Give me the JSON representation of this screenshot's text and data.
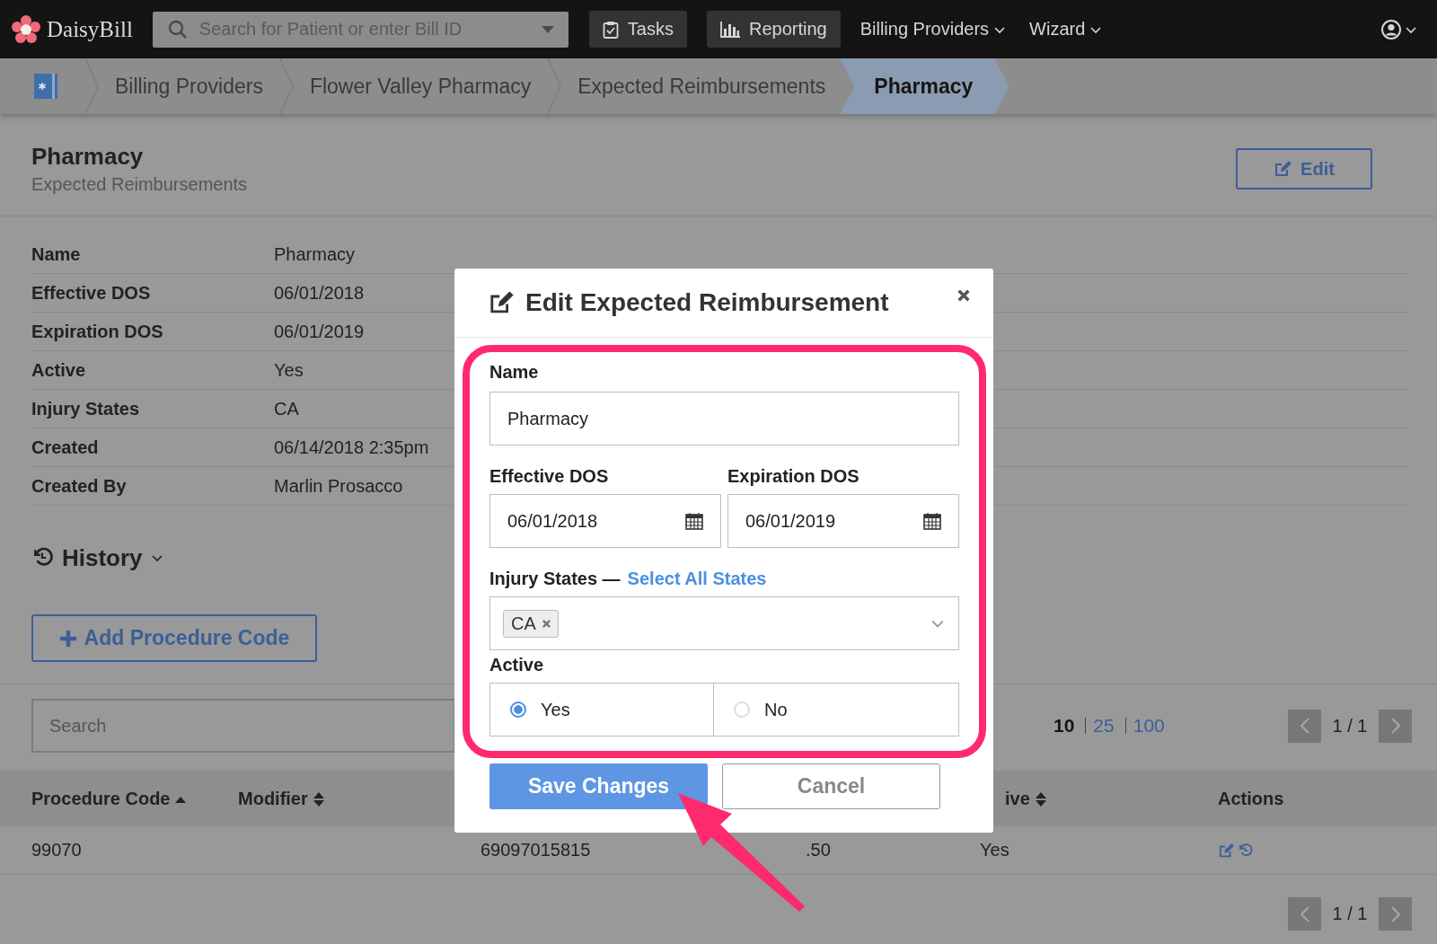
{
  "nav": {
    "logo": "DaisyBill",
    "search": {
      "placeholder": "Search for Patient or enter Bill ID"
    },
    "items": [
      {
        "label": "Tasks",
        "kind": "button"
      },
      {
        "label": "Reporting",
        "kind": "button"
      },
      {
        "label": "Billing Providers",
        "kind": "menu"
      },
      {
        "label": "Wizard",
        "kind": "menu"
      }
    ]
  },
  "breadcrumbs": [
    {
      "label": "Billing Providers",
      "selected": false
    },
    {
      "label": "Flower Valley Pharmacy",
      "selected": false
    },
    {
      "label": "Expected Reimbursements",
      "selected": false
    },
    {
      "label": "Pharmacy",
      "selected": true
    }
  ],
  "header": {
    "title": "Pharmacy",
    "subtitle": "Expected Reimbursements",
    "edit_button": "Edit"
  },
  "details": [
    {
      "label": "Name",
      "value": "Pharmacy"
    },
    {
      "label": "Effective DOS",
      "value": "06/01/2018"
    },
    {
      "label": "Expiration DOS",
      "value": "06/01/2019"
    },
    {
      "label": "Active",
      "value": "Yes"
    },
    {
      "label": "Injury States",
      "value": "CA"
    },
    {
      "label": "Created",
      "value": "06/14/2018 2:35pm"
    },
    {
      "label": "Created By",
      "value": "Marlin Prosacco"
    }
  ],
  "history": {
    "label": "History",
    "expanded": false
  },
  "add_button": "Add Procedure Code",
  "table_search": {
    "placeholder": "Search"
  },
  "page_sizes": [
    {
      "label": "10",
      "selected": true
    },
    {
      "label": "25",
      "selected": false
    },
    {
      "label": "100",
      "selected": false
    }
  ],
  "pager_top": "1 / 1",
  "table": {
    "columns": [
      {
        "label": "Procedure Code",
        "kind": "sorted"
      },
      {
        "label": "Modifier",
        "kind": "sortable"
      },
      {
        "kind": "hidden"
      },
      {
        "kind": "hidden"
      },
      {
        "label": "ive",
        "kind": "sortable"
      },
      {
        "label": "Actions",
        "kind": "plain"
      }
    ],
    "rows": [
      {
        "cells": [
          "99070",
          "",
          "69097015815",
          ".50",
          "Yes"
        ]
      }
    ]
  },
  "pager_bottom": "1 / 1",
  "modal": {
    "title": "Edit Expected Reimbursement",
    "name": {
      "label": "Name",
      "value": "Pharmacy"
    },
    "dates": [
      {
        "label": "Effective DOS",
        "value": "06/01/2018"
      },
      {
        "label": "Expiration DOS",
        "value": "06/01/2019"
      }
    ],
    "states": {
      "label": "Injury States —",
      "link": "Select All States",
      "tags": [
        "CA"
      ]
    },
    "active": {
      "label": "Active",
      "options": [
        {
          "label": "Yes",
          "selected": true
        },
        {
          "label": "No",
          "selected": false
        }
      ]
    },
    "save": "Save Changes",
    "cancel": "Cancel"
  },
  "annotations": {
    "highlight": true,
    "arrow": true
  }
}
